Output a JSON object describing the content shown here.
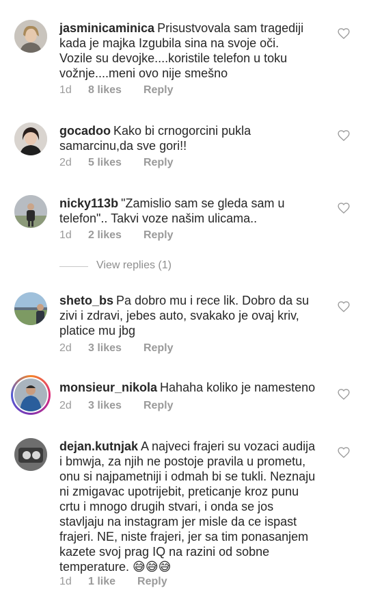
{
  "comments": [
    {
      "username": "jasminicaminica",
      "text": "Prisustvovala sam tragediji\nkada je majka Izgubila sina na svoje oči.\nVozile su devojke....koristile telefon u toku\nvožnje....meni ovo nije smešno",
      "time": "1d",
      "likes": "8 likes",
      "reply": "Reply"
    },
    {
      "username": "gocadoo",
      "text": "Kako bi crnogorcini pukla\nsamarcinu,da sve gori!!",
      "time": "2d",
      "likes": "5 likes",
      "reply": "Reply"
    },
    {
      "username": "nicky113b",
      "text": "\"Zamislio sam se gleda sam u\ntelefon\".. Takvi voze našim ulicama..",
      "time": "1d",
      "likes": "2 likes",
      "reply": "Reply"
    },
    {
      "username": "sheto_bs",
      "text": "Pa dobro mu i rece lik. Dobro da su\nzivi i zdravi, jebes auto, svakako je ovaj kriv,\nplatice mu jbg",
      "time": "2d",
      "likes": "3 likes",
      "reply": "Reply"
    },
    {
      "username": "monsieur_nikola",
      "text": "Hahaha koliko je namesteno",
      "time": "2d",
      "likes": "3 likes",
      "reply": "Reply"
    },
    {
      "username": "dejan.kutnjak",
      "text": "A najveci frajeri su vozaci audija\ni bmwja, za njih ne postoje pravila u prometu,\nonu si najpametniji i odmah bi se tukli. Neznaju\nni zmigavac upotrijebit, preticanje kroz punu\ncrtu i mnogo drugih stvari, i onda se jos\nstavljaju na instagram jer misle da ce ispast\nfrajeri. NE, niste frajeri, jer sa tim ponasanjem\nkazete svoj prag IQ na razini od sobne\ntemperature. 😅😅😅",
      "time": "1d",
      "likes": "1 like",
      "reply": "Reply"
    }
  ],
  "view_replies": "View replies (1)",
  "icons": {
    "like": "heart-outline-icon"
  },
  "colors": {
    "text": "#262626",
    "meta": "#9a9a9a",
    "divider": "#c7c7c7"
  }
}
